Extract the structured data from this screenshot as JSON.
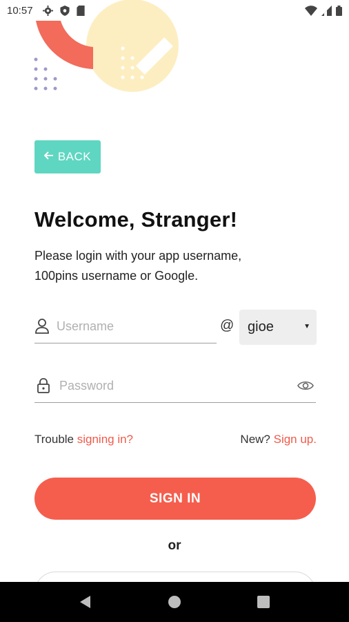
{
  "status_bar": {
    "time": "10:57",
    "left_icons": [
      "gear-icon",
      "shield-icon",
      "sd-card-icon"
    ],
    "right_icons": [
      "wifi-icon",
      "signal-icon",
      "battery-icon"
    ]
  },
  "back_button": {
    "label": "BACK",
    "icon": "arrow-left-icon"
  },
  "heading": {
    "title": "Welcome, Stranger!",
    "subtitle": "Please login with your app username, 100pins username or Google."
  },
  "form": {
    "username": {
      "placeholder": "Username",
      "value": "",
      "icon": "user-icon"
    },
    "at_sign": "@",
    "domain": {
      "selected": "gioe"
    },
    "password": {
      "placeholder": "Password",
      "value": "",
      "icon": "lock-icon",
      "toggle_icon": "eye-icon"
    }
  },
  "links": {
    "trouble_prefix": "Trouble ",
    "trouble_link": "signing in?",
    "new_prefix": "New? ",
    "signup_link": "Sign up."
  },
  "sign_in_label": "SIGN IN",
  "or_label": "or",
  "colors": {
    "accent": "#f55e4d",
    "back_button": "#5fd6c1",
    "decor_red": "#f26b5b",
    "decor_yellow": "#fdeec2",
    "decor_dots": "#9e9ac8"
  },
  "nav_bar": [
    "back-triangle-icon",
    "home-circle-icon",
    "overview-square-icon"
  ]
}
